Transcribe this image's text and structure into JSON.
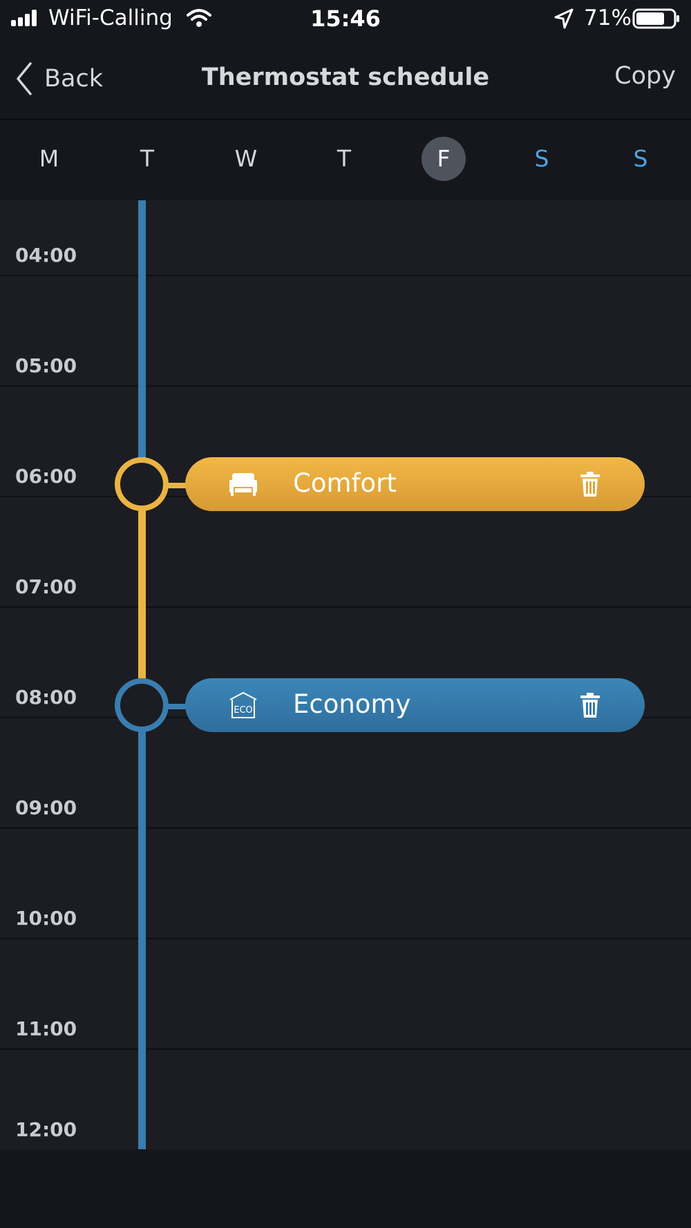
{
  "status_bar": {
    "carrier": "WiFi-Calling",
    "time": "15:46",
    "battery_percent": "71%",
    "icons": [
      "signal-icon",
      "wifi-icon",
      "location-icon",
      "battery-icon"
    ]
  },
  "nav": {
    "back_label": "Back",
    "title": "Thermostat schedule",
    "copy_label": "Copy"
  },
  "days": [
    {
      "label": "M",
      "selected": false,
      "weekend": false
    },
    {
      "label": "T",
      "selected": false,
      "weekend": false
    },
    {
      "label": "W",
      "selected": false,
      "weekend": false
    },
    {
      "label": "T",
      "selected": false,
      "weekend": false
    },
    {
      "label": "F",
      "selected": true,
      "weekend": false
    },
    {
      "label": "S",
      "selected": false,
      "weekend": true
    },
    {
      "label": "S",
      "selected": false,
      "weekend": true
    }
  ],
  "hours": [
    "04:00",
    "05:00",
    "06:00",
    "07:00",
    "08:00",
    "09:00",
    "10:00",
    "11:00",
    "12:00"
  ],
  "events": [
    {
      "time": "06:00",
      "label": "Comfort",
      "mode": "comfort",
      "icon": "sofa-icon",
      "action_icon": "trash-icon"
    },
    {
      "time": "08:00",
      "label": "Economy",
      "mode": "economy",
      "icon": "eco-house-icon",
      "action_icon": "trash-icon"
    }
  ],
  "colors": {
    "comfort": "#eab443",
    "economy": "#3a7db0",
    "weekend_text": "#4ea3e0",
    "selected_day_bg": "#4e535c"
  }
}
